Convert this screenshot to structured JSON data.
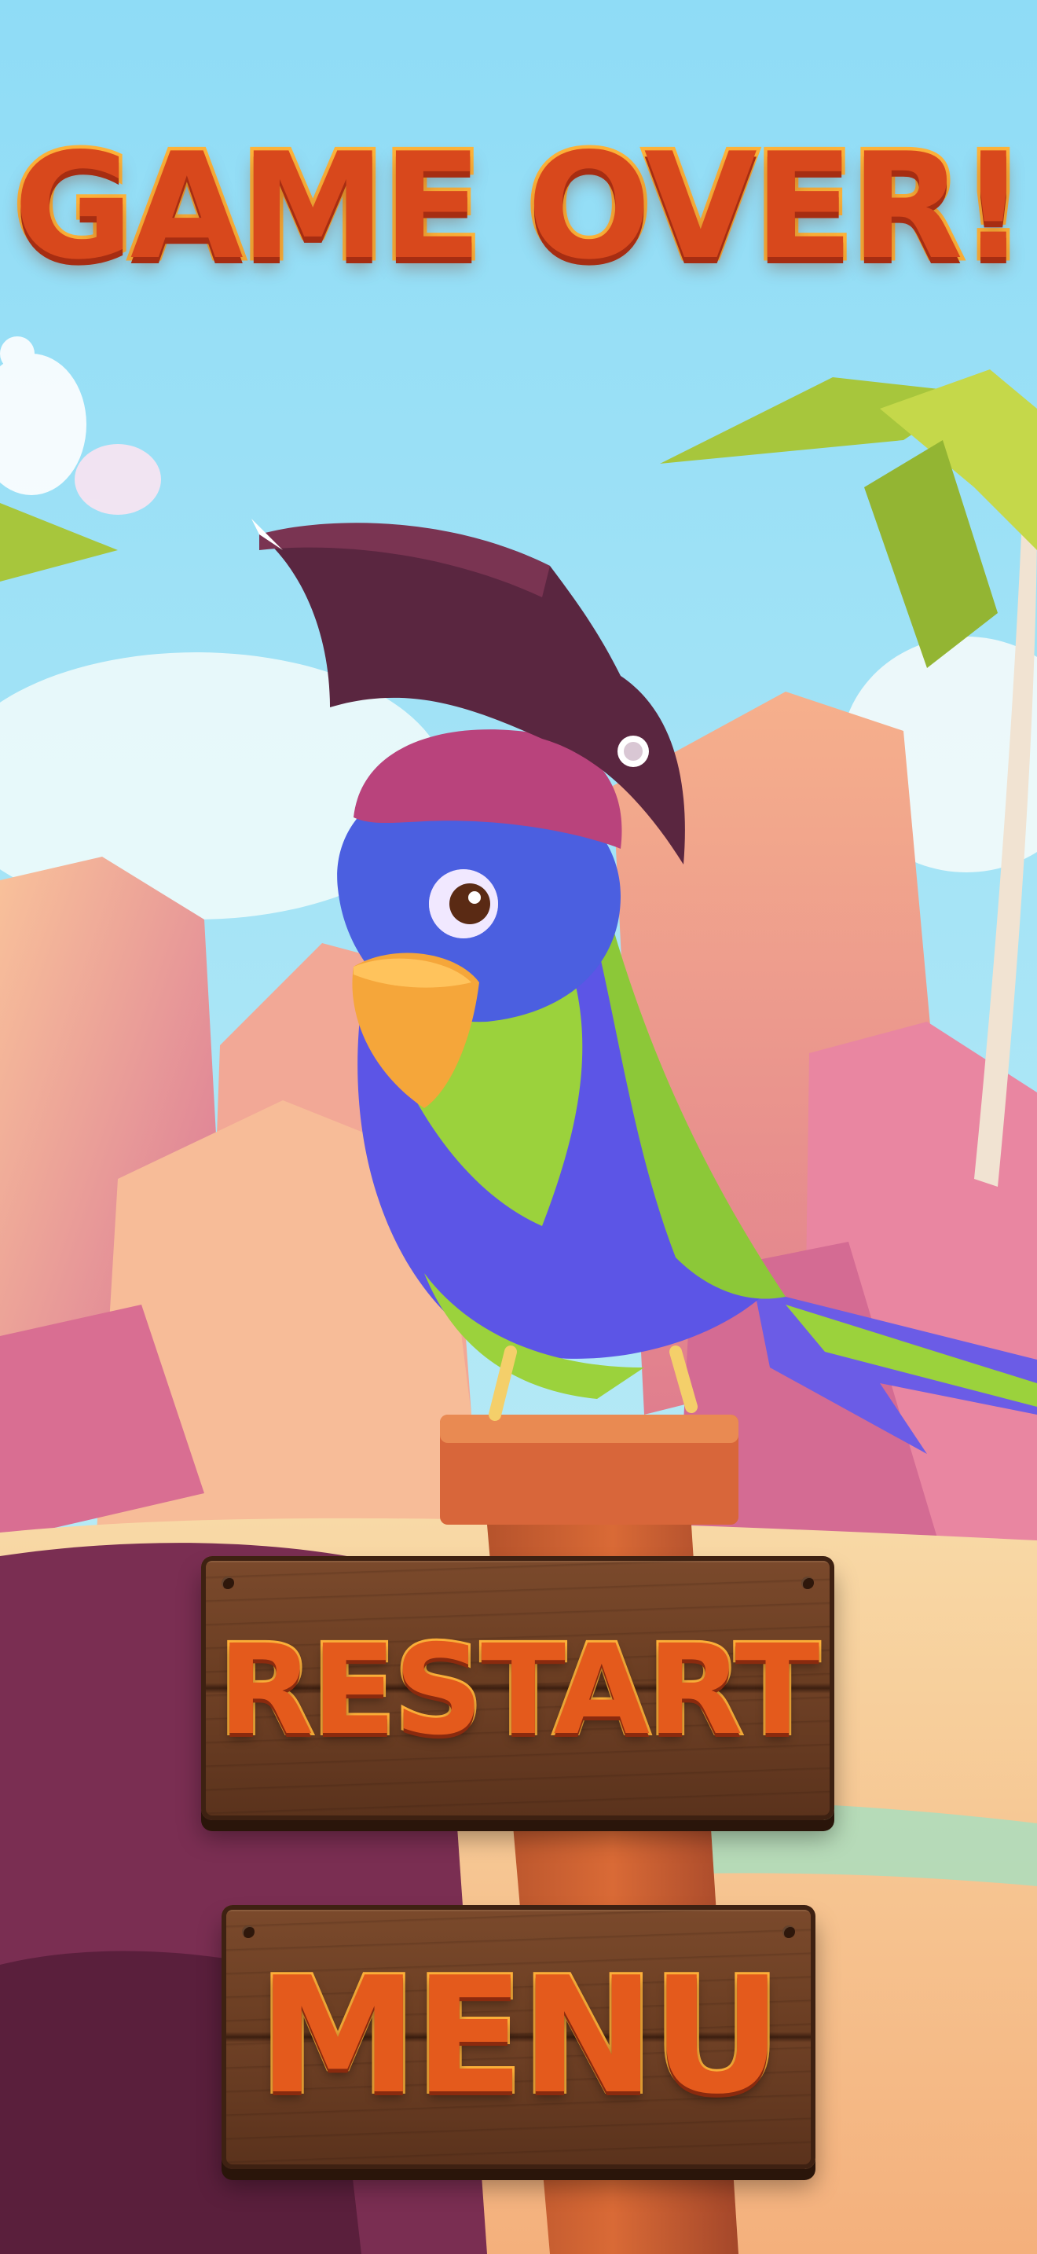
{
  "game_over": {
    "title": "GAME OVER!"
  },
  "buttons": {
    "restart_label": "RESTART",
    "menu_label": "MENU"
  },
  "colors": {
    "sky_top": "#8fdcf6",
    "sky_bottom": "#c8f0f5",
    "title_fill": "#d8481c",
    "title_outline": "#ffb53a",
    "wood": "#6a3d22",
    "button_text": "#e45a1c",
    "parrot_blue": "#4b5fe0",
    "parrot_green": "#9bd23c",
    "hat": "#5a2640"
  },
  "scene": {
    "character": "pirate-parrot",
    "background": "tropical-canyon"
  }
}
